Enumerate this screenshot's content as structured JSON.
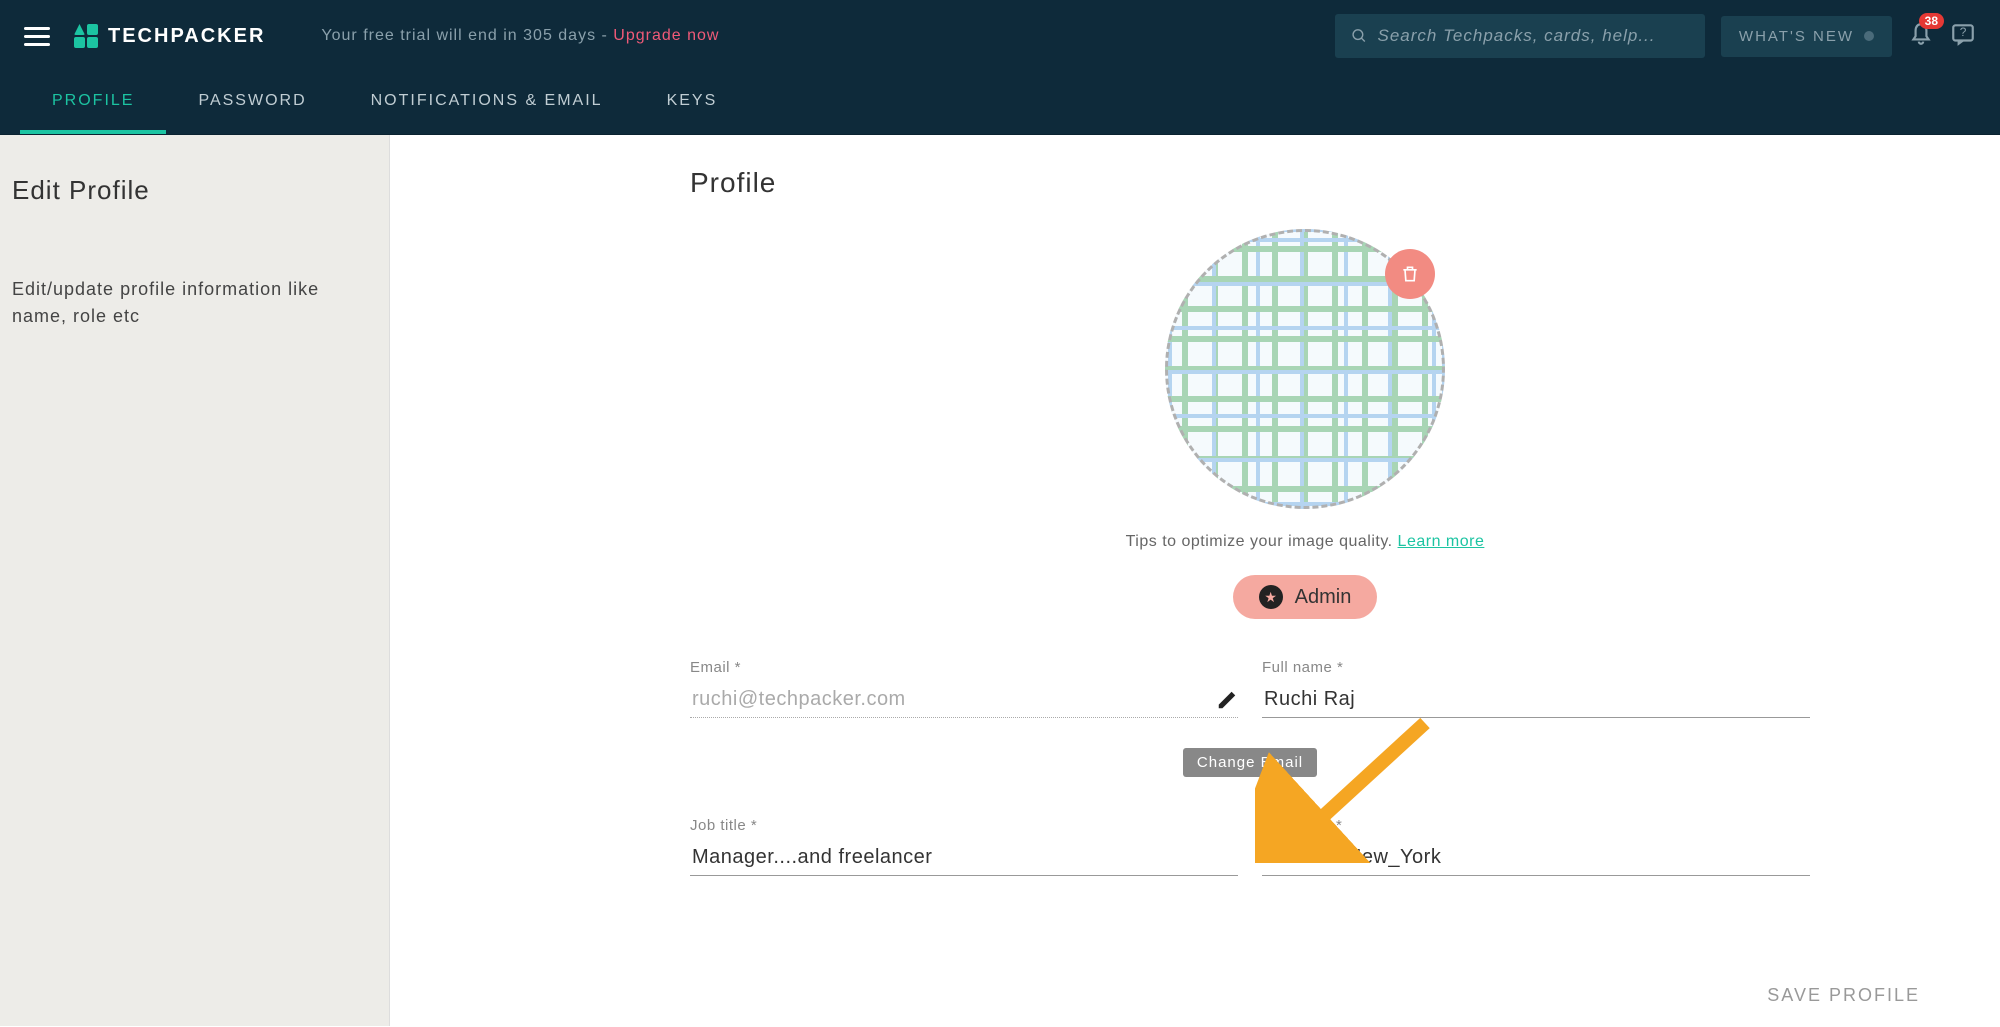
{
  "header": {
    "brand": "TECHPACKER",
    "trial_prefix": "Your free trial will end in 305 days - ",
    "upgrade_label": "Upgrade now",
    "search_placeholder": "Search Techpacks, cards, help...",
    "whats_new_label": "WHAT'S NEW",
    "notif_count": "38"
  },
  "tabs": {
    "items": [
      "PROFILE",
      "PASSWORD",
      "NOTIFICATIONS & EMAIL",
      "KEYS"
    ],
    "active_index": 0
  },
  "sidebar": {
    "title": "Edit Profile",
    "description": "Edit/update profile information like name, role etc"
  },
  "main": {
    "heading": "Profile",
    "tips_text": "Tips to optimize your image quality. ",
    "learn_more": "Learn more",
    "role_label": "Admin",
    "fields": {
      "email_label": "Email *",
      "email_value": "ruchi@techpacker.com",
      "fullname_label": "Full name *",
      "fullname_value": "Ruchi Raj",
      "jobtitle_label": "Job title *",
      "jobtitle_value": "Manager....and freelancer",
      "timezone_label": "Timezone *",
      "timezone_value": "America/New_York"
    },
    "change_email_label": "Change Email",
    "save_label": "SAVE PROFILE"
  }
}
